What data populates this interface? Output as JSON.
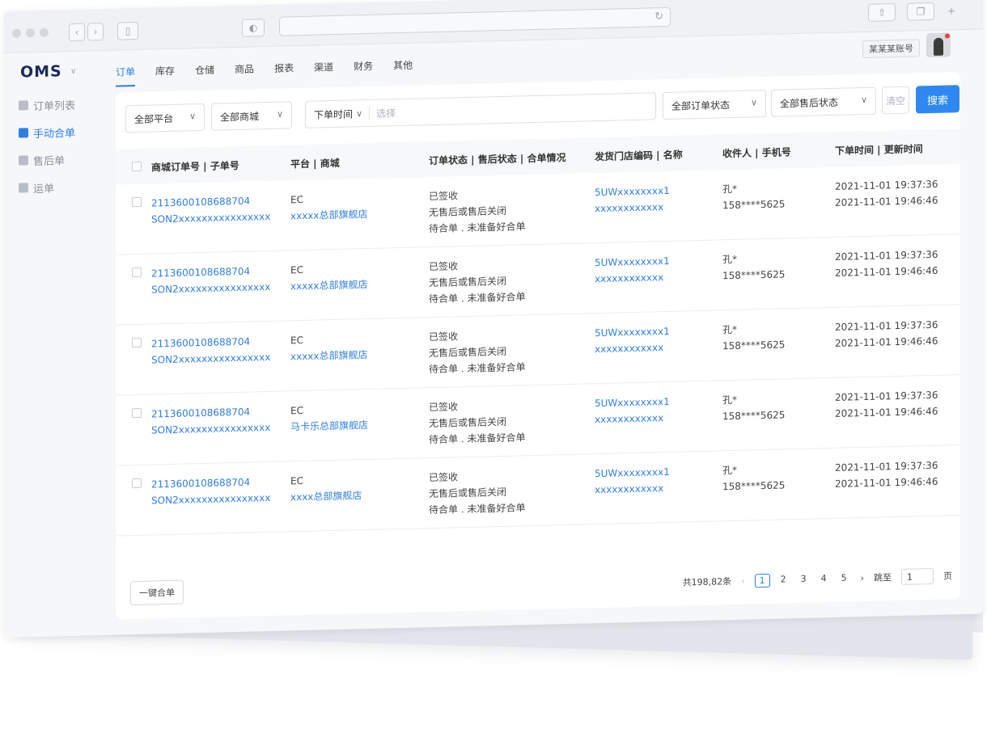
{
  "browser": {
    "back_icon": "chevron-left-icon",
    "forward_icon": "chevron-right-icon",
    "sidebar_icon": "sidebar-icon",
    "shield_icon": "shield-icon",
    "reload_icon": "reload-icon",
    "share_icon": "share-icon",
    "tabs_icon": "tabs-icon",
    "new_tab_icon": "plus-icon"
  },
  "header": {
    "logo": "OMS",
    "nav": [
      {
        "label": "订单",
        "active": true
      },
      {
        "label": "库存"
      },
      {
        "label": "仓储"
      },
      {
        "label": "商品"
      },
      {
        "label": "报表"
      },
      {
        "label": "渠道"
      },
      {
        "label": "财务"
      },
      {
        "label": "其他"
      }
    ],
    "account": "某某某账号"
  },
  "sidebar": {
    "items": [
      {
        "label": "订单列表",
        "icon": "list-icon"
      },
      {
        "label": "手动合单",
        "icon": "merge-icon",
        "active": true
      },
      {
        "label": "售后单",
        "icon": "after-sale-icon"
      },
      {
        "label": "运单",
        "icon": "truck-icon"
      }
    ]
  },
  "filters": {
    "platform": "全部平台",
    "mall": "全部商城",
    "time_type": "下单时间",
    "time_placeholder": "选择",
    "order_status": "全部订单状态",
    "aftersale_status": "全部售后状态",
    "clear": "清空",
    "search": "搜索"
  },
  "table": {
    "headers": [
      "商城订单号 | 子单号",
      "平台 | 商城",
      "订单状态 | 售后状态 | 合单情况",
      "发货门店编码 | 名称",
      "收件人 | 手机号",
      "下单时间 | 更新时间"
    ],
    "rows": [
      {
        "order_no": "2113600108688704",
        "sub_no": "SON2xxxxxxxxxxxxxxxx",
        "platform": "EC",
        "mall": "xxxxx总部旗舰店",
        "status": "已签收",
        "aftersale": "无售后或售后关闭",
        "merge": "待合单 . 未准备好合单",
        "store_code": "5UWxxxxxxxx1",
        "store_name": "xxxxxxxxxxxx",
        "recipient": "孔*",
        "phone": "158****5625",
        "order_time": "2021-11-01 19:37:36",
        "update_time": "2021-11-01 19:46:46"
      },
      {
        "order_no": "2113600108688704",
        "sub_no": "SON2xxxxxxxxxxxxxxxx",
        "platform": "EC",
        "mall": "xxxxx总部旗舰店",
        "status": "已签收",
        "aftersale": "无售后或售后关闭",
        "merge": "待合单 . 未准备好合单",
        "store_code": "5UWxxxxxxxx1",
        "store_name": "xxxxxxxxxxxx",
        "recipient": "孔*",
        "phone": "158****5625",
        "order_time": "2021-11-01 19:37:36",
        "update_time": "2021-11-01 19:46:46"
      },
      {
        "order_no": "2113600108688704",
        "sub_no": "SON2xxxxxxxxxxxxxxxx",
        "platform": "EC",
        "mall": "xxxxx总部旗舰店",
        "status": "已签收",
        "aftersale": "无售后或售后关闭",
        "merge": "待合单 . 未准备好合单",
        "store_code": "5UWxxxxxxxx1",
        "store_name": "xxxxxxxxxxxx",
        "recipient": "孔*",
        "phone": "158****5625",
        "order_time": "2021-11-01 19:37:36",
        "update_time": "2021-11-01 19:46:46"
      },
      {
        "order_no": "2113600108688704",
        "sub_no": "SON2xxxxxxxxxxxxxxxx",
        "platform": "EC",
        "mall": "马卡乐总部旗舰店",
        "status": "已签收",
        "aftersale": "无售后或售后关闭",
        "merge": "待合单 . 未准备好合单",
        "store_code": "5UWxxxxxxxx1",
        "store_name": "xxxxxxxxxxxx",
        "recipient": "孔*",
        "phone": "158****5625",
        "order_time": "2021-11-01 19:37:36",
        "update_time": "2021-11-01 19:46:46"
      },
      {
        "order_no": "2113600108688704",
        "sub_no": "SON2xxxxxxxxxxxxxxxx",
        "platform": "EC",
        "mall": "xxxx总部旗舰店",
        "status": "已签收",
        "aftersale": "无售后或售后关闭",
        "merge": "待合单 . 未准备好合单",
        "store_code": "5UWxxxxxxxx1",
        "store_name": "xxxxxxxxxxxx",
        "recipient": "孔*",
        "phone": "158****5625",
        "order_time": "2021-11-01 19:37:36",
        "update_time": "2021-11-01 19:46:46"
      }
    ]
  },
  "footer": {
    "merge_button": "一键合单",
    "total": "共198,82条",
    "pages": [
      "1",
      "2",
      "3",
      "4",
      "5"
    ],
    "current_page": "1",
    "jump_label": "跳至",
    "jump_value": "1",
    "page_unit": "页"
  },
  "colors": {
    "accent": "#2f88f0",
    "link": "#2f7fe0"
  }
}
